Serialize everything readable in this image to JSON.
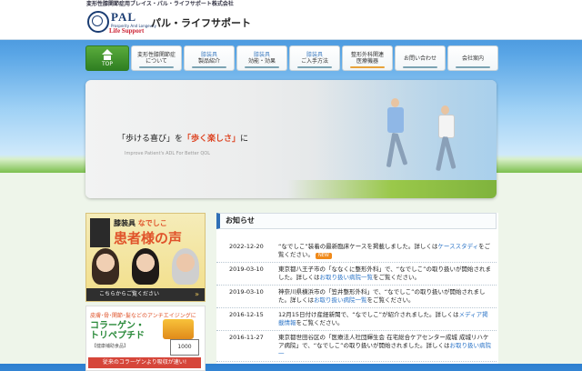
{
  "top_strip": "変形性膝関節症用ブレイス・パル・ライフサポート株式会社",
  "logo": {
    "pal": "PAL",
    "sub": "Prosperity And Longevity",
    "life": "Life Support",
    "name": "パル・ライフサポート"
  },
  "nav": [
    {
      "small": "",
      "label": "TOP"
    },
    {
      "small": "",
      "label": "変形性膝関節症\nについて"
    },
    {
      "small": "膝装具",
      "label": "製品紹介"
    },
    {
      "small": "膝装具",
      "label": "効能・効果"
    },
    {
      "small": "膝装具",
      "label": "ご入手方法"
    },
    {
      "small": "",
      "label": "整形外科関連\n医療機器"
    },
    {
      "small": "",
      "label": "お問い合わせ"
    },
    {
      "small": "",
      "label": "会社案内"
    }
  ],
  "hero": {
    "q1": "「歩ける喜び」",
    "wo": "を",
    "q2": "「歩く楽しさ」",
    "ni": "に",
    "en": "Improve Patient's ADL For Better QOL"
  },
  "ad1": {
    "l1a": "膝装具",
    "l1b": "なでしこ",
    "l2": "患者様の声",
    "cta": "こちらからご覧ください"
  },
  "ad2": {
    "l1": "皮膚･骨･関節･髪などのアンチエイジングに",
    "l2a": "コラーゲン・",
    "l2b": "トリペプチド",
    "l3": "【健康補助食品】",
    "badge": "1000",
    "bar": "従来のコラーゲンより吸収が速い!"
  },
  "news": {
    "title": "お知らせ",
    "items": [
      {
        "date": "2022-12-20",
        "pre": "“なでしこ”装着の最新臨床ケースを掲載しました。詳しくは",
        "link": "ケーススタディ",
        "post": "をご覧ください。",
        "new": "NEW"
      },
      {
        "date": "2019-03-10",
        "pre": "東京都八王子市の「ななくに整形外科」で、“なでしこ”の取り扱いが開始されました。詳しくは",
        "link": "お取り扱い病院一覧",
        "post": "をご覧ください。",
        "new": ""
      },
      {
        "date": "2019-03-10",
        "pre": "神奈川県横浜市の「笠井整形外科」で、“なでしこ”の取り扱いが開始されました。詳しくは",
        "link": "お取り扱い病院一覧",
        "post": "をご覧ください。",
        "new": ""
      },
      {
        "date": "2016-12-15",
        "pre": "12月15日付け産経新聞で、“なでしこ”が紹介されました。詳しくは",
        "link": "メディア掲載情報",
        "post": "をご覧ください。",
        "new": ""
      },
      {
        "date": "2016-11-27",
        "pre": "東京都世田谷区の「医療法人社団輝生会 在宅総合ケアセンター成城 成城リハケア病院」で、“なでしこ”の取り扱いが開始されました。詳しくは",
        "link": "お取り扱い病院一",
        "post": "",
        "new": ""
      }
    ]
  }
}
